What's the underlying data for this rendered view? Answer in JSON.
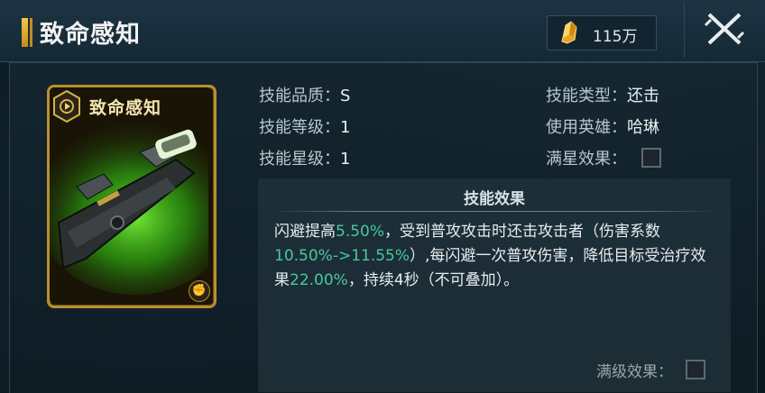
{
  "header": {
    "title": "致命感知",
    "currency_value": "115万",
    "currency_icon": "gold-crystal-icon",
    "close_icon": "close-x-icon"
  },
  "card": {
    "title": "致命感知",
    "badge_icon": "gear-play-badge-icon",
    "art": "green-glowing-gun",
    "corner_icon": "fist-icon"
  },
  "attributes": {
    "quality_label": "技能品质：",
    "quality_value": "S",
    "level_label": "技能等级：",
    "level_value": "1",
    "star_label": "技能星级：",
    "star_value": "1",
    "type_label": "技能类型：",
    "type_value": "还击",
    "hero_label": "使用英雄：",
    "hero_value": "哈琳",
    "fullstar_label": "满星效果："
  },
  "effect": {
    "title": "技能效果",
    "t1": "闪避提高",
    "v1": "5.50%",
    "t2": "，受到普攻攻击时还击攻击者（伤害系数",
    "v2": "10.50%->11.55%",
    "t3": "）,每闪避一次普攻伤害，降低目标受治疗效果",
    "v3": "22.00%",
    "t4": "，持续4秒（不可叠加）。",
    "highlight_color": "#48c99a",
    "maxlevel_label": "满级效果："
  }
}
